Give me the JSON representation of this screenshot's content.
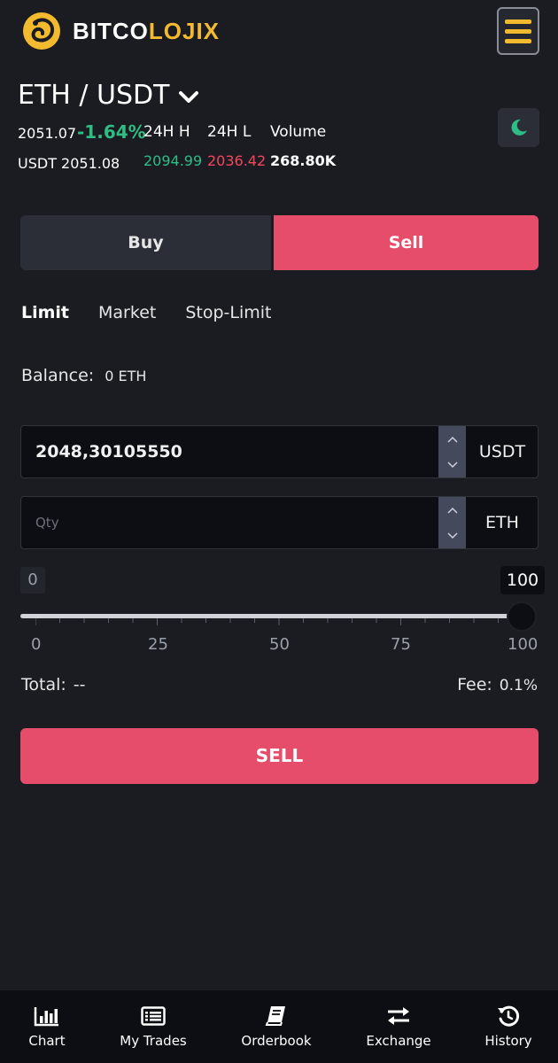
{
  "header": {
    "logo_text_white": "BITCO",
    "logo_text_yellow": "LOJIX",
    "menu_icon": "hamburger-icon",
    "brand_color": "#f3ba2f"
  },
  "pair": {
    "title": "ETH / USDT",
    "last_price": "2051.07",
    "change": "-1.64%",
    "usdt_price": "USDT 2051.08",
    "high_label": "24H H",
    "low_label": "24H L",
    "volume_label": "Volume",
    "high_value": "2094.99",
    "low_value": "2036.42",
    "volume_value": "268.80K"
  },
  "theme_toggle_icon": "moon-icon",
  "side_tabs": {
    "buy": "Buy",
    "sell": "Sell",
    "active": "sell"
  },
  "order_types": [
    "Limit",
    "Market",
    "Stop-Limit"
  ],
  "balance": {
    "label": "Balance:",
    "value": "0 ETH"
  },
  "price_field": {
    "value": "2048,30105550",
    "unit": "USDT"
  },
  "qty_field": {
    "placeholder": "Qty",
    "unit": "ETH"
  },
  "slider": {
    "min_label": "0",
    "max_label": "100",
    "value_percent": 100,
    "tick_labels": [
      "0",
      "25",
      "50",
      "75",
      "100"
    ]
  },
  "total": {
    "label": "Total:",
    "value": "--"
  },
  "fee": {
    "label": "Fee:",
    "value": "0.1%"
  },
  "submit_label": "SELL",
  "colors": {
    "sell": "#e54d6a",
    "up": "#2ebd85",
    "down": "#f6465d"
  },
  "bottom_nav": [
    {
      "label": "Chart",
      "icon": "chart-icon"
    },
    {
      "label": "My Trades",
      "icon": "list-icon"
    },
    {
      "label": "Orderbook",
      "icon": "book-icon"
    },
    {
      "label": "Exchange",
      "icon": "exchange-icon"
    },
    {
      "label": "History",
      "icon": "history-icon"
    }
  ]
}
